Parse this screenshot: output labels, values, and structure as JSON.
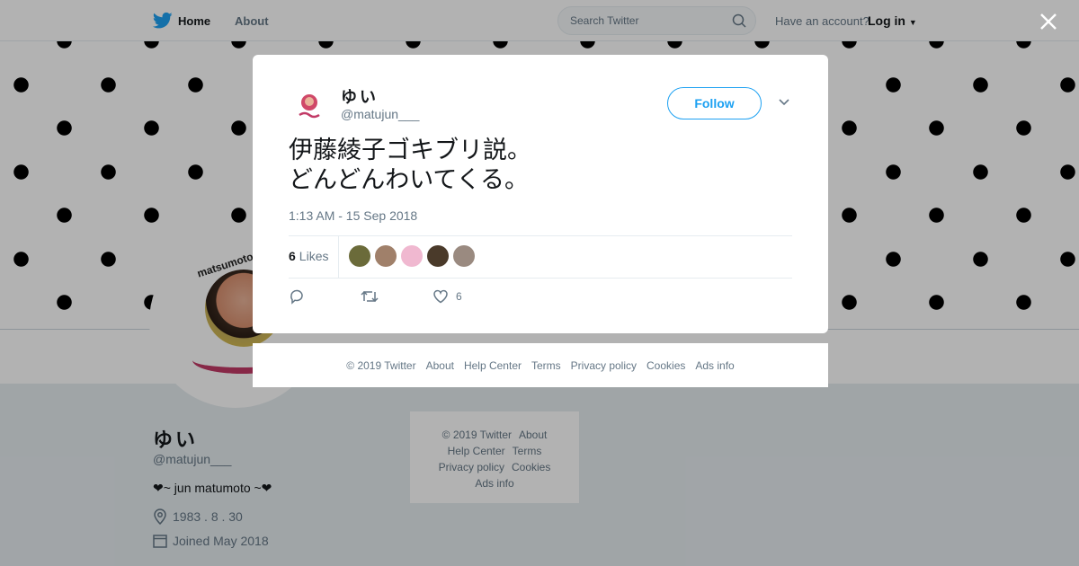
{
  "topbar": {
    "home_label": "Home",
    "about_label": "About",
    "search_placeholder": "Search Twitter",
    "account_prompt": "Have an account?",
    "login_label": "Log in"
  },
  "profile": {
    "name": "ゆい",
    "handle": "@matujun___",
    "bio": "❤~ jun matumoto ~❤",
    "birthday": "1983 . 8 . 30",
    "joined": "Joined May 2018",
    "avatar_text": "matsumoto"
  },
  "bg_footer": {
    "row1": [
      "© 2019 Twitter",
      "About"
    ],
    "row2": [
      "Help Center",
      "Terms"
    ],
    "row3": [
      "Privacy policy",
      "Cookies"
    ],
    "row4": [
      "Ads info"
    ]
  },
  "tweet": {
    "name": "ゆい",
    "handle": "@matujun___",
    "follow_label": "Follow",
    "text": "伊藤綾子ゴキブリ説。\nどんどんわいてくる。",
    "timestamp": "1:13 AM - 15 Sep 2018",
    "likes_count": "6",
    "likes_label": "Likes",
    "like_action_count": "6",
    "liker_colors": [
      "#6b6b3a",
      "#a0806a",
      "#f0b8d0",
      "#4a3a2a",
      "#9a8a80"
    ]
  },
  "modal_footer": {
    "items": [
      "© 2019 Twitter",
      "About",
      "Help Center",
      "Terms",
      "Privacy policy",
      "Cookies",
      "Ads info"
    ]
  },
  "colors": {
    "accent": "#1da1f2",
    "muted": "#657786",
    "text": "#14171a"
  }
}
